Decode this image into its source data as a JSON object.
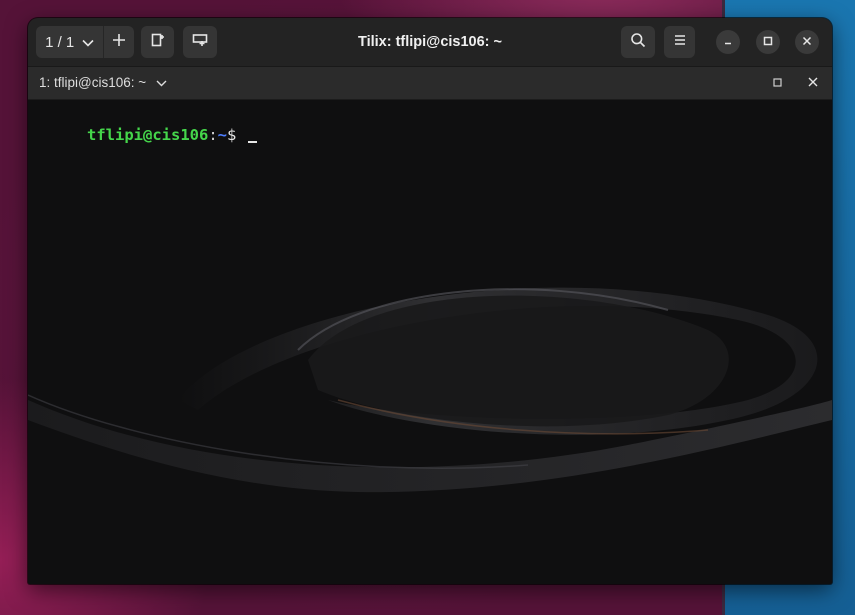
{
  "window": {
    "title": "Tilix: tflipi@cis106: ~"
  },
  "toolbar": {
    "session_indicator": "1 / 1",
    "icons": {
      "session_dropdown": "chevron-down-icon",
      "add_session": "plus-icon",
      "add_terminal_right": "split-right-icon",
      "add_terminal_down": "split-down-icon",
      "find": "search-icon",
      "menu": "hamburger-menu-icon",
      "minimize": "minimize-icon",
      "maximize": "maximize-icon",
      "close": "close-icon"
    }
  },
  "terminal_tab": {
    "title": "1: tflipi@cis106: ~"
  },
  "terminal": {
    "prompt_user_host": "tflipi@cis106",
    "prompt_colon": ":",
    "prompt_path": "~",
    "prompt_symbol": "$"
  },
  "colors": {
    "prompt_user_host": "#45d64b",
    "prompt_path": "#4d7dff",
    "titlebar_bg": "#232323",
    "terminal_bg": "#0f0f10"
  }
}
